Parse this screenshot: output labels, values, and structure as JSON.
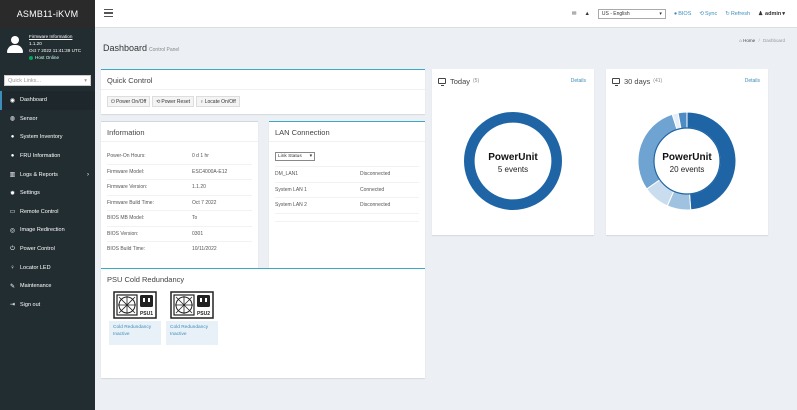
{
  "brand": "ASMB11-iKVM",
  "user": {
    "firmware_info": "Firmware Information",
    "version": "1.1.20",
    "datetime": "Oct 7 2022 11:41:39 UTC",
    "status": "Host Online"
  },
  "quick_links": {
    "placeholder": "Quick Links..."
  },
  "sidebar": {
    "items": [
      {
        "label": "Dashboard",
        "icon": "dashboard-icon"
      },
      {
        "label": "Sensor",
        "icon": "sensor-icon"
      },
      {
        "label": "System Inventory",
        "icon": "info-icon"
      },
      {
        "label": "FRU Information",
        "icon": "info-icon"
      },
      {
        "label": "Logs & Reports",
        "icon": "chart-icon"
      },
      {
        "label": "Settings",
        "icon": "gear-icon"
      },
      {
        "label": "Remote Control",
        "icon": "monitor-icon"
      },
      {
        "label": "Image Redirection",
        "icon": "disc-icon"
      },
      {
        "label": "Power Control",
        "icon": "power-icon"
      },
      {
        "label": "Locator LED",
        "icon": "bulb-icon"
      },
      {
        "label": "Maintenance",
        "icon": "wrench-icon"
      },
      {
        "label": "Sign out",
        "icon": "signout-icon"
      }
    ]
  },
  "topbar": {
    "language": "US - English",
    "bios": "BIOS",
    "sync": "Sync",
    "refresh": "Refresh",
    "user": "admin"
  },
  "page": {
    "title": "Dashboard",
    "subtitle": "Control Panel",
    "breadcrumb_home": "Home",
    "breadcrumb_current": "Dashboard"
  },
  "quick_control": {
    "title": "Quick Control",
    "power_onoff": "Power On/Off",
    "power_reset": "Power Reset",
    "locate_onoff": "Locate On/Off"
  },
  "information": {
    "title": "Information",
    "rows": [
      {
        "key": "Power-On Hours:",
        "value": "0 d 1 hr"
      },
      {
        "key": "Firmware Model:",
        "value": "ESC4000A-E12"
      },
      {
        "key": "Firmware Version:",
        "value": "1.1.20"
      },
      {
        "key": "Firmware Build Time:",
        "value": "Oct 7 2022"
      },
      {
        "key": "BIOS MB Model:",
        "value": "To"
      },
      {
        "key": "BIOS Version:",
        "value": "0301"
      },
      {
        "key": "BIOS Build Time:",
        "value": "10/11/2022"
      }
    ]
  },
  "lan": {
    "title": "LAN Connection",
    "select": "Link Status",
    "rows": [
      {
        "key": "DM_LAN1",
        "value": "Disconnected"
      },
      {
        "key": "System LAN 1",
        "value": "Connected"
      },
      {
        "key": "System LAN 2",
        "value": "Disconnected"
      }
    ]
  },
  "today": {
    "title": "Today",
    "count": "(5)",
    "details": "Details",
    "center_title": "PowerUnit",
    "center_text": "5 events",
    "segments": [
      {
        "value": 1,
        "color": "#1f65a6"
      }
    ]
  },
  "thirty": {
    "title": "30 days",
    "count": "(41)",
    "details": "Details",
    "center_title": "PowerUnit",
    "center_text": "20 events",
    "segments": [
      {
        "value": 20,
        "color": "#1f65a6"
      },
      {
        "value": 3.2,
        "color": "#9ec2e0"
      },
      {
        "value": 3.6,
        "color": "#c9ddef"
      },
      {
        "value": 12.2,
        "color": "#6fa3d1"
      },
      {
        "value": 0.8,
        "color": "#e6eef7"
      },
      {
        "value": 1.2,
        "color": "#4d8cc5"
      }
    ]
  },
  "psu": {
    "title": "PSU Cold Redundancy",
    "items": [
      {
        "tag": "PSU1",
        "line1": "Cold Redundancy",
        "line2": "Inactive"
      },
      {
        "tag": "PSU2",
        "line1": "Cold Redundancy",
        "line2": "Inactive"
      }
    ]
  },
  "colors": {
    "sidebar": "#222d32",
    "accent": "#3c8dbc",
    "donut_primary": "#1f65a6"
  }
}
